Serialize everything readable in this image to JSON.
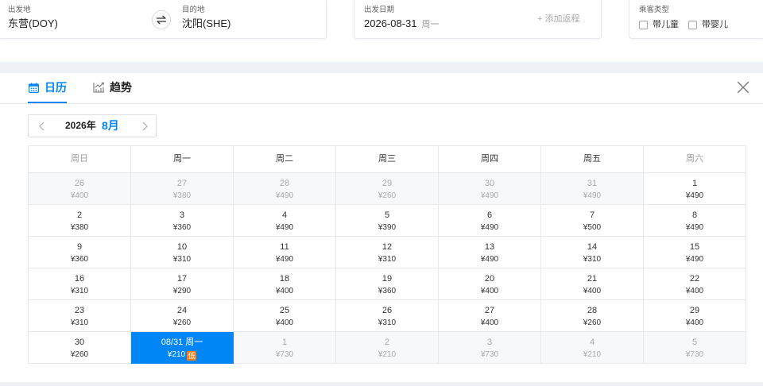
{
  "search": {
    "departure": {
      "label": "出发地",
      "value": "东营(DOY)"
    },
    "destination": {
      "label": "目的地",
      "value": "沈阳(SHE)"
    },
    "date": {
      "label": "出发日期",
      "value": "2026-08-31",
      "weekday": "周一"
    },
    "add_return": "+ 添加返程",
    "passenger": {
      "label": "乘客类型",
      "options": [
        {
          "label": "带儿童",
          "checked": false
        },
        {
          "label": "带婴儿",
          "checked": false
        }
      ]
    }
  },
  "tabs": [
    {
      "label": "日历",
      "icon": "calendar-icon",
      "active": true
    },
    {
      "label": "趋势",
      "icon": "trend-chart-icon",
      "active": false
    }
  ],
  "icons": {
    "swap": "swap-icon",
    "close": "close-icon",
    "prev_month": "chevron-left-icon",
    "next_month": "chevron-right-icon",
    "checkbox": "checkbox-icon"
  },
  "month_nav": {
    "year": "2026年",
    "month": "8月"
  },
  "calendar": {
    "weekdays": [
      "周日",
      "周一",
      "周二",
      "周三",
      "周四",
      "周五",
      "周六"
    ],
    "weeks": [
      [
        {
          "day": "26",
          "price": "¥400",
          "muted": true
        },
        {
          "day": "27",
          "price": "¥380",
          "muted": true
        },
        {
          "day": "28",
          "price": "¥490",
          "muted": true
        },
        {
          "day": "29",
          "price": "¥260",
          "muted": true
        },
        {
          "day": "30",
          "price": "¥490",
          "muted": true
        },
        {
          "day": "31",
          "price": "¥490",
          "muted": true
        },
        {
          "day": "1",
          "price": "¥490"
        }
      ],
      [
        {
          "day": "2",
          "price": "¥380"
        },
        {
          "day": "3",
          "price": "¥360"
        },
        {
          "day": "4",
          "price": "¥490"
        },
        {
          "day": "5",
          "price": "¥390"
        },
        {
          "day": "6",
          "price": "¥490"
        },
        {
          "day": "7",
          "price": "¥500"
        },
        {
          "day": "8",
          "price": "¥490"
        }
      ],
      [
        {
          "day": "9",
          "price": "¥360"
        },
        {
          "day": "10",
          "price": "¥310"
        },
        {
          "day": "11",
          "price": "¥490"
        },
        {
          "day": "12",
          "price": "¥310"
        },
        {
          "day": "13",
          "price": "¥490"
        },
        {
          "day": "14",
          "price": "¥310"
        },
        {
          "day": "15",
          "price": "¥490"
        }
      ],
      [
        {
          "day": "16",
          "price": "¥310"
        },
        {
          "day": "17",
          "price": "¥290"
        },
        {
          "day": "18",
          "price": "¥400"
        },
        {
          "day": "19",
          "price": "¥360"
        },
        {
          "day": "20",
          "price": "¥400"
        },
        {
          "day": "21",
          "price": "¥400"
        },
        {
          "day": "22",
          "price": "¥400"
        }
      ],
      [
        {
          "day": "23",
          "price": "¥310"
        },
        {
          "day": "24",
          "price": "¥260"
        },
        {
          "day": "25",
          "price": "¥400"
        },
        {
          "day": "26",
          "price": "¥310"
        },
        {
          "day": "27",
          "price": "¥400"
        },
        {
          "day": "28",
          "price": "¥260"
        },
        {
          "day": "29",
          "price": "¥400"
        }
      ],
      [
        {
          "day": "30",
          "price": "¥260"
        },
        {
          "day": "08/31 周一",
          "price": "¥210",
          "tag": "低",
          "selected": true
        },
        {
          "day": "1",
          "price": "¥730",
          "muted": true
        },
        {
          "day": "2",
          "price": "¥210",
          "muted": true
        },
        {
          "day": "3",
          "price": "¥730",
          "muted": true
        },
        {
          "day": "4",
          "price": "¥210",
          "muted": true
        },
        {
          "day": "5",
          "price": "¥730",
          "muted": true
        }
      ]
    ]
  },
  "colors": {
    "accent": "#0086f6",
    "low_badge": "#ff7d13"
  }
}
